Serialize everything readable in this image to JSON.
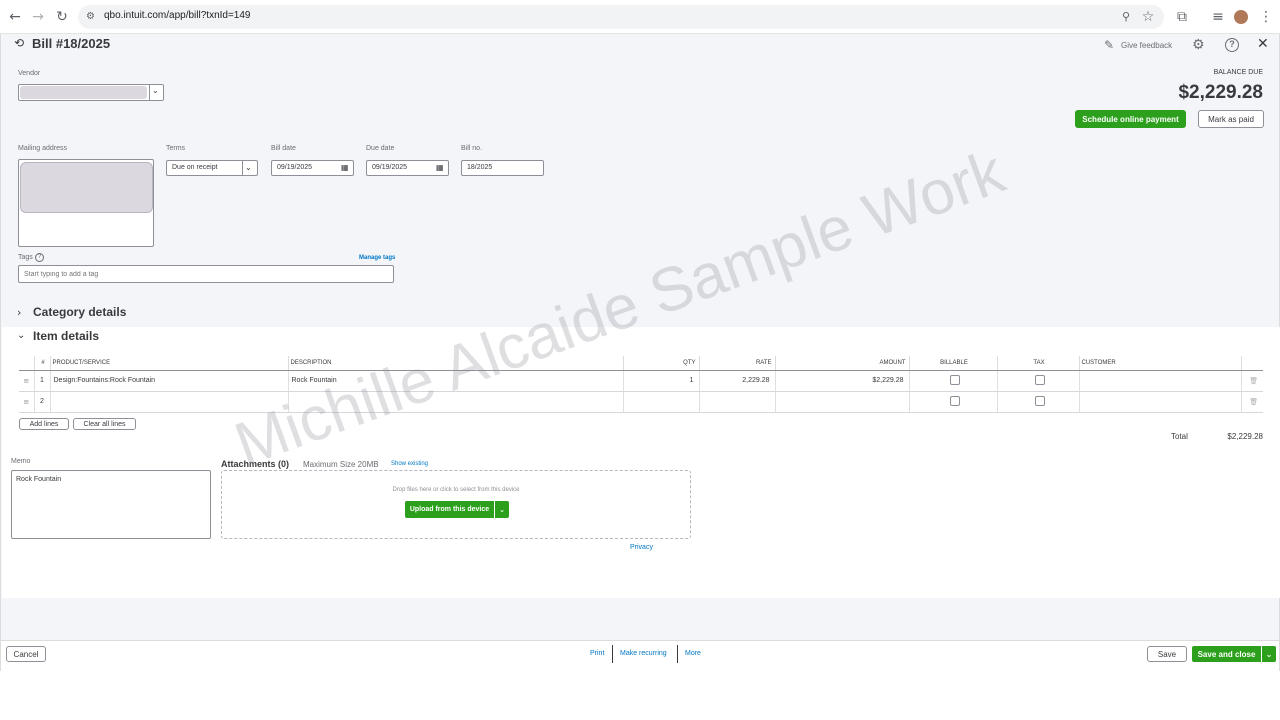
{
  "browser": {
    "url": "qbo.intuit.com/app/bill?txnId=149"
  },
  "header": {
    "title": "Bill #18/2025",
    "give_feedback": "Give feedback",
    "balance_due_label": "BALANCE DUE",
    "balance_due_amount": "$2,229.28",
    "schedule_payment": "Schedule online payment",
    "mark_as_paid": "Mark as paid"
  },
  "form": {
    "vendor_label": "Vendor",
    "mailing_address_label": "Mailing address",
    "terms_label": "Terms",
    "terms_value": "Due on receipt",
    "bill_date_label": "Bill date",
    "bill_date_value": "09/19/2025",
    "due_date_label": "Due date",
    "due_date_value": "09/19/2025",
    "bill_no_label": "Bill no.",
    "bill_no_value": "18/2025",
    "tags_label": "Tags",
    "manage_tags": "Manage tags",
    "tags_placeholder": "Start typing to add a tag"
  },
  "sections": {
    "category_details": "Category details",
    "item_details": "Item details"
  },
  "table": {
    "headers": {
      "num": "#",
      "product": "PRODUCT/SERVICE",
      "description": "DESCRIPTION",
      "qty": "QTY",
      "rate": "RATE",
      "amount": "AMOUNT",
      "billable": "BILLABLE",
      "tax": "TAX",
      "customer": "CUSTOMER"
    },
    "rows": [
      {
        "num": "1",
        "product": "Design:Fountains:Rock Fountain",
        "description": "Rock Fountain",
        "qty": "1",
        "rate": "2,229.28",
        "amount": "$2,229.28"
      },
      {
        "num": "2",
        "product": "",
        "description": "",
        "qty": "",
        "rate": "",
        "amount": ""
      }
    ],
    "add_lines": "Add lines",
    "clear_all_lines": "Clear all lines",
    "total_label": "Total",
    "total_value": "$2,229.28"
  },
  "memo": {
    "label": "Memo",
    "value": "Rock Fountain"
  },
  "attachments": {
    "title": "Attachments (0)",
    "max_size": "Maximum Size 20MB",
    "show_existing": "Show existing",
    "drop_text": "Drop files here or click to select from this device",
    "upload_button": "Upload from this device",
    "privacy": "Privacy"
  },
  "watermark": "Michille Alcaide Sample Work",
  "footer": {
    "cancel": "Cancel",
    "print": "Print",
    "make_recurring": "Make recurring",
    "more": "More",
    "save": "Save",
    "save_and_close": "Save and close"
  },
  "colors": {
    "brand_green": "#2ca01c",
    "link_blue": "#0077c5",
    "page_bg": "#f4f5f8"
  }
}
